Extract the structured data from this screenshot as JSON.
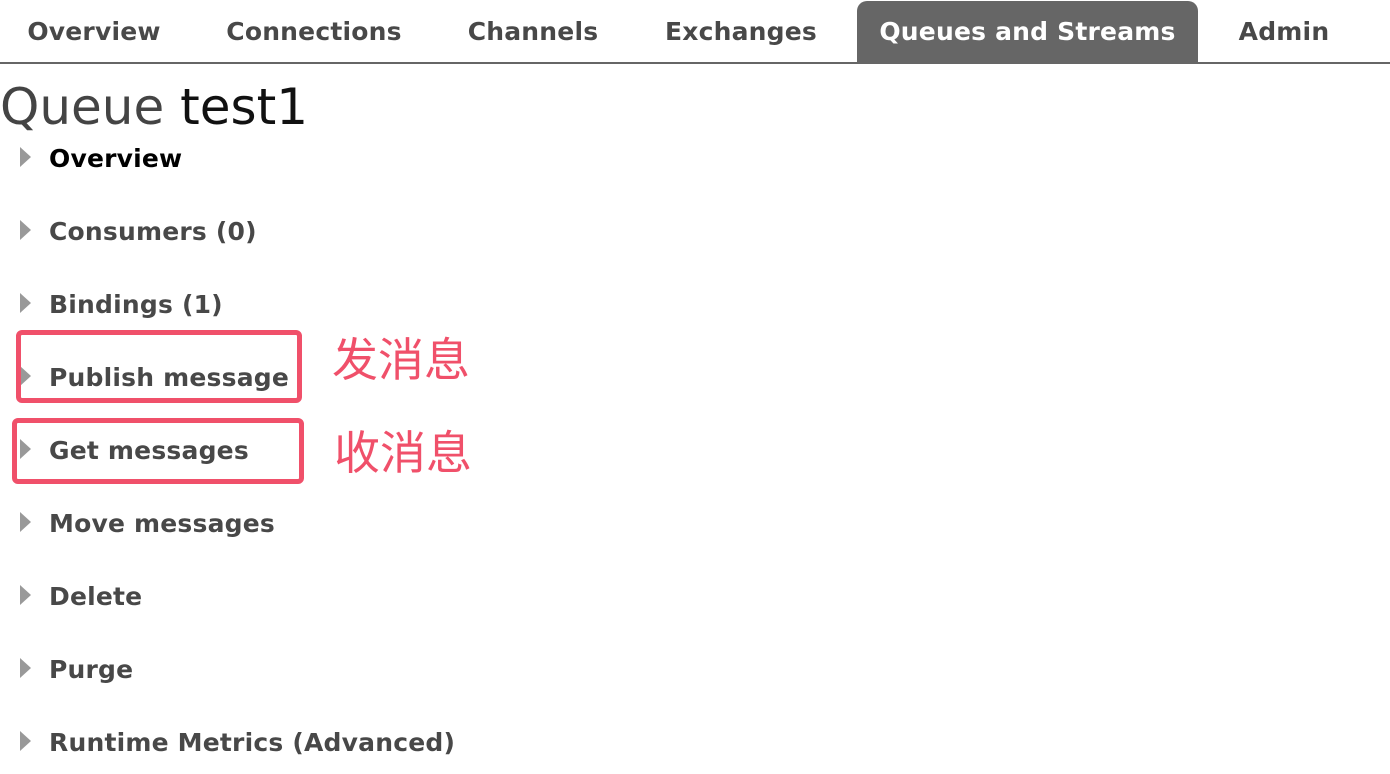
{
  "nav": {
    "tabs": [
      {
        "label": "Overview",
        "active": false
      },
      {
        "label": "Connections",
        "active": false
      },
      {
        "label": "Channels",
        "active": false
      },
      {
        "label": "Exchanges",
        "active": false
      },
      {
        "label": "Queues and Streams",
        "active": true
      },
      {
        "label": "Admin",
        "active": false
      }
    ]
  },
  "page": {
    "title_prefix": "Queue",
    "queue_name": "test1"
  },
  "sections": [
    {
      "label": "Overview",
      "current": true
    },
    {
      "label": "Consumers (0)",
      "current": false
    },
    {
      "label": "Bindings (1)",
      "current": false
    },
    {
      "label": "Publish message",
      "current": false
    },
    {
      "label": "Get messages",
      "current": false
    },
    {
      "label": "Move messages",
      "current": false
    },
    {
      "label": "Delete",
      "current": false
    },
    {
      "label": "Purge",
      "current": false
    },
    {
      "label": "Runtime Metrics (Advanced)",
      "current": false
    }
  ],
  "annotations": {
    "publish_note": "发消息",
    "get_note": "收消息",
    "color": "#f0506a"
  },
  "colors": {
    "active_tab_bg": "#666666",
    "text": "#484848",
    "arrow": "#999999"
  },
  "icons": {
    "section_toggle": "triangle-right-icon"
  }
}
